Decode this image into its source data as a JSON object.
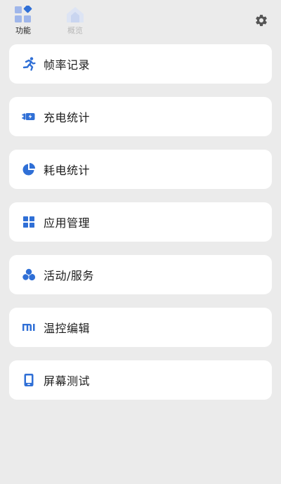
{
  "top_tabs": [
    {
      "label": "功能",
      "icon": "grid-diamond-icon",
      "active": true
    },
    {
      "label": "概览",
      "icon": "house-icon",
      "active": false
    }
  ],
  "settings_icon": "gear-icon",
  "accent_color": "#2f6fd6",
  "menu": [
    {
      "label": "帧率记录",
      "icon": "running-person-icon"
    },
    {
      "label": "充电统计",
      "icon": "battery-charging-icon"
    },
    {
      "label": "耗电统计",
      "icon": "pie-chart-icon"
    },
    {
      "label": "应用管理",
      "icon": "app-grid-icon"
    },
    {
      "label": "活动/服务",
      "icon": "three-circles-icon"
    },
    {
      "label": "温控编辑",
      "icon": "mi-logo-icon"
    },
    {
      "label": "屏幕测试",
      "icon": "phone-screen-icon"
    }
  ]
}
